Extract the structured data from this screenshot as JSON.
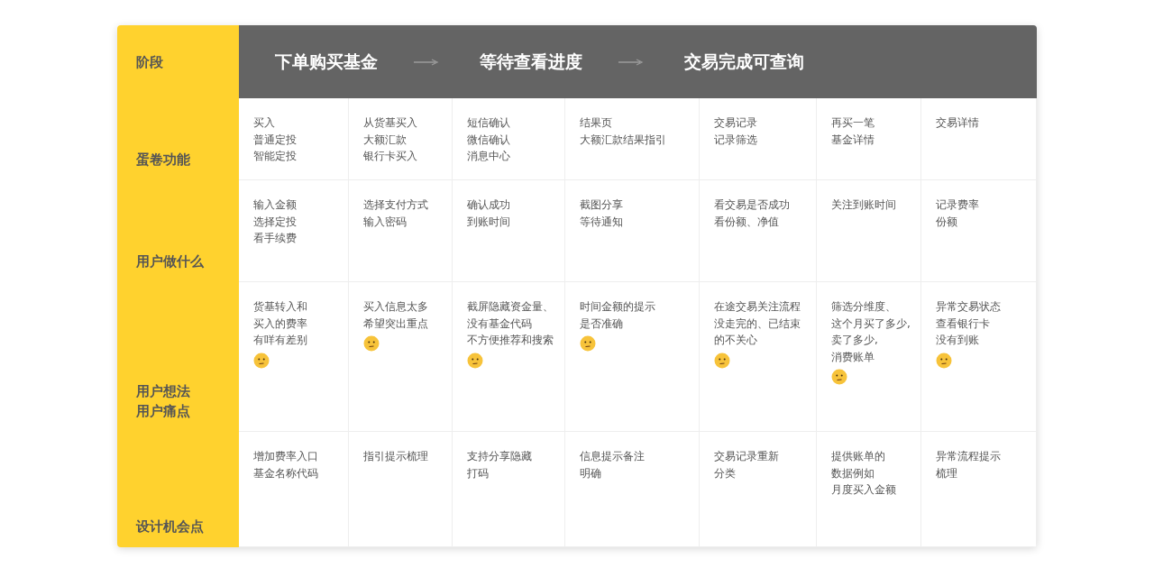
{
  "stage_label": "阶段",
  "phases": [
    "下单购买基金",
    "等待查看进度",
    "交易完成可查询"
  ],
  "rows": [
    {
      "label": [
        "蛋卷功能"
      ],
      "cells": [
        {
          "lines": [
            "买入",
            "普通定投",
            "智能定投"
          ]
        },
        {
          "lines": [
            "从货基买入",
            "大额汇款",
            "银行卡买入"
          ]
        },
        {
          "lines": [
            "短信确认",
            "微信确认",
            "消息中心"
          ]
        },
        {
          "lines": [
            "结果页",
            "大额汇款结果指引"
          ]
        },
        {
          "lines": [
            "交易记录",
            "记录筛选"
          ]
        },
        {
          "lines": [
            "再买一笔",
            "基金详情"
          ]
        },
        {
          "lines": [
            "交易详情"
          ]
        }
      ]
    },
    {
      "label": [
        "用户做什么"
      ],
      "cells": [
        {
          "lines": [
            "输入金额",
            "选择定投",
            "看手续费"
          ]
        },
        {
          "lines": [
            "选择支付方式",
            "输入密码"
          ]
        },
        {
          "lines": [
            "确认成功",
            "到账时间"
          ]
        },
        {
          "lines": [
            "截图分享",
            "等待通知"
          ]
        },
        {
          "lines": [
            "看交易是否成功",
            "看份额、净值"
          ]
        },
        {
          "lines": [
            "关注到账时间"
          ]
        },
        {
          "lines": [
            "记录费率",
            "份额"
          ]
        }
      ]
    },
    {
      "label": [
        "用户想法",
        "用户痛点"
      ],
      "cells": [
        {
          "lines": [
            "货基转入和",
            "买入的费率",
            "有咩有差别"
          ],
          "emoji": true
        },
        {
          "lines": [
            "买入信息太多",
            "希望突出重点"
          ],
          "emoji": true
        },
        {
          "lines": [
            "截屏隐藏资金量、",
            "没有基金代码",
            "不方便推荐和搜索"
          ],
          "emoji": true
        },
        {
          "lines": [
            "时间金额的提示",
            "是否准确"
          ],
          "emoji": true
        },
        {
          "lines": [
            "在途交易关注流程",
            "没走完的、已结束",
            "的不关心"
          ],
          "emoji": true
        },
        {
          "lines": [
            "筛选分维度、",
            "这个月买了多少,",
            "卖了多少,",
            "消费账单"
          ],
          "emoji": true
        },
        {
          "lines": [
            "异常交易状态",
            "查看银行卡",
            "没有到账"
          ],
          "emoji": true
        }
      ]
    },
    {
      "label": [
        "设计机会点"
      ],
      "cells": [
        {
          "lines": [
            "增加费率入口",
            "基金名称代码"
          ]
        },
        {
          "lines": [
            "指引提示梳理"
          ]
        },
        {
          "lines": [
            "支持分享隐藏",
            "打码"
          ]
        },
        {
          "lines": [
            "信息提示备注",
            "明确"
          ]
        },
        {
          "lines": [
            "交易记录重新",
            "分类"
          ]
        },
        {
          "lines": [
            "提供账单的",
            "数据例如",
            "月度买入金额"
          ]
        },
        {
          "lines": [
            "异常流程提示",
            "梳理"
          ]
        }
      ]
    }
  ]
}
